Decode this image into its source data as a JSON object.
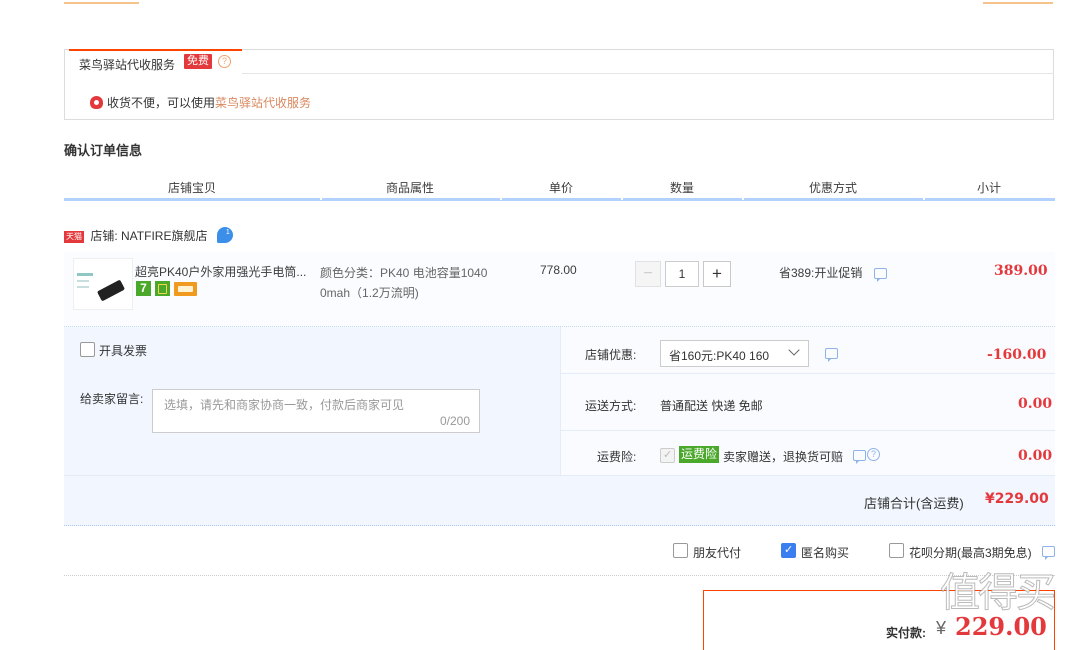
{
  "cainiao": {
    "tab_label": "菜鸟驿站代收服务",
    "free_badge": "免费",
    "notice_text": "收货不便，可以使用",
    "notice_link": "菜鸟驿站代收服务"
  },
  "section_title": "确认订单信息",
  "columns": [
    "店铺宝贝",
    "商品属性",
    "单价",
    "数量",
    "优惠方式",
    "小计"
  ],
  "shop": {
    "tmall_badge": "天猫",
    "label": "店铺: NATFIRE旗舰店"
  },
  "item": {
    "title": "超亮PK40户外家用强光手电筒...",
    "badge_7": "7",
    "attr_line1": "颜色分类：PK40 电池容量1040",
    "attr_line2": "0mah（1.2万流明)",
    "unit_price": "778.00",
    "quantity": "1",
    "minus": "−",
    "plus": "+",
    "promo": "省389:开业促销",
    "subtotal": "389.00"
  },
  "invoice_label": "开具发票",
  "message": {
    "label": "给卖家留言:",
    "placeholder": "选填，请先和商家协商一致，付款后商家可见",
    "counter": "0/200"
  },
  "shop_discount": {
    "label": "店铺优惠:",
    "select_value": "省160元:PK40 160",
    "amount": "-160.00"
  },
  "shipping": {
    "label": "运送方式:",
    "value": "普通配送 快递 免邮",
    "amount": "0.00"
  },
  "insurance": {
    "label": "运费险:",
    "badge": "运费险",
    "text": "卖家赠送，退换货可赔",
    "amount": "0.00"
  },
  "shop_total": {
    "label": "店铺合计(含运费)",
    "value": "¥229.00"
  },
  "options": {
    "friend_pay": "朋友代付",
    "anonymous": "匿名购买",
    "huabei": "花呗分期(最高3期免息)"
  },
  "payment": {
    "label": "实付款:",
    "currency": "¥",
    "value": "229.00"
  },
  "watermark": "值得买"
}
